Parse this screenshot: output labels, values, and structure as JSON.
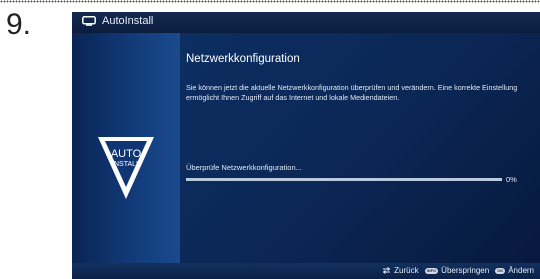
{
  "step": {
    "number": "9."
  },
  "titlebar": {
    "title": "AutoInstall",
    "icon": "tv-icon"
  },
  "logo": {
    "line1": "AUTO",
    "line2": "INSTALL"
  },
  "main": {
    "heading": "Netzwerkkonfiguration",
    "description": "Sie können jetzt die aktuelle Netzwerkkonfiguration überprüfen und verändern. Eine korrekte Einstellung ermöglicht Ihnen Zugriff auf das Internet und lokale Mediendateien.",
    "status": "Überprüfe Netzwerkkonfiguration...",
    "progress_percent": 0,
    "progress_label": "0%"
  },
  "footer": {
    "back_label": "Zurück",
    "skip_key": "INFO",
    "skip_label": "Überspringen",
    "change_key": "OK",
    "change_label": "Ändern"
  },
  "colors": {
    "background": "#06152e",
    "panel": "#0c2e62",
    "text": "#ffffff"
  }
}
